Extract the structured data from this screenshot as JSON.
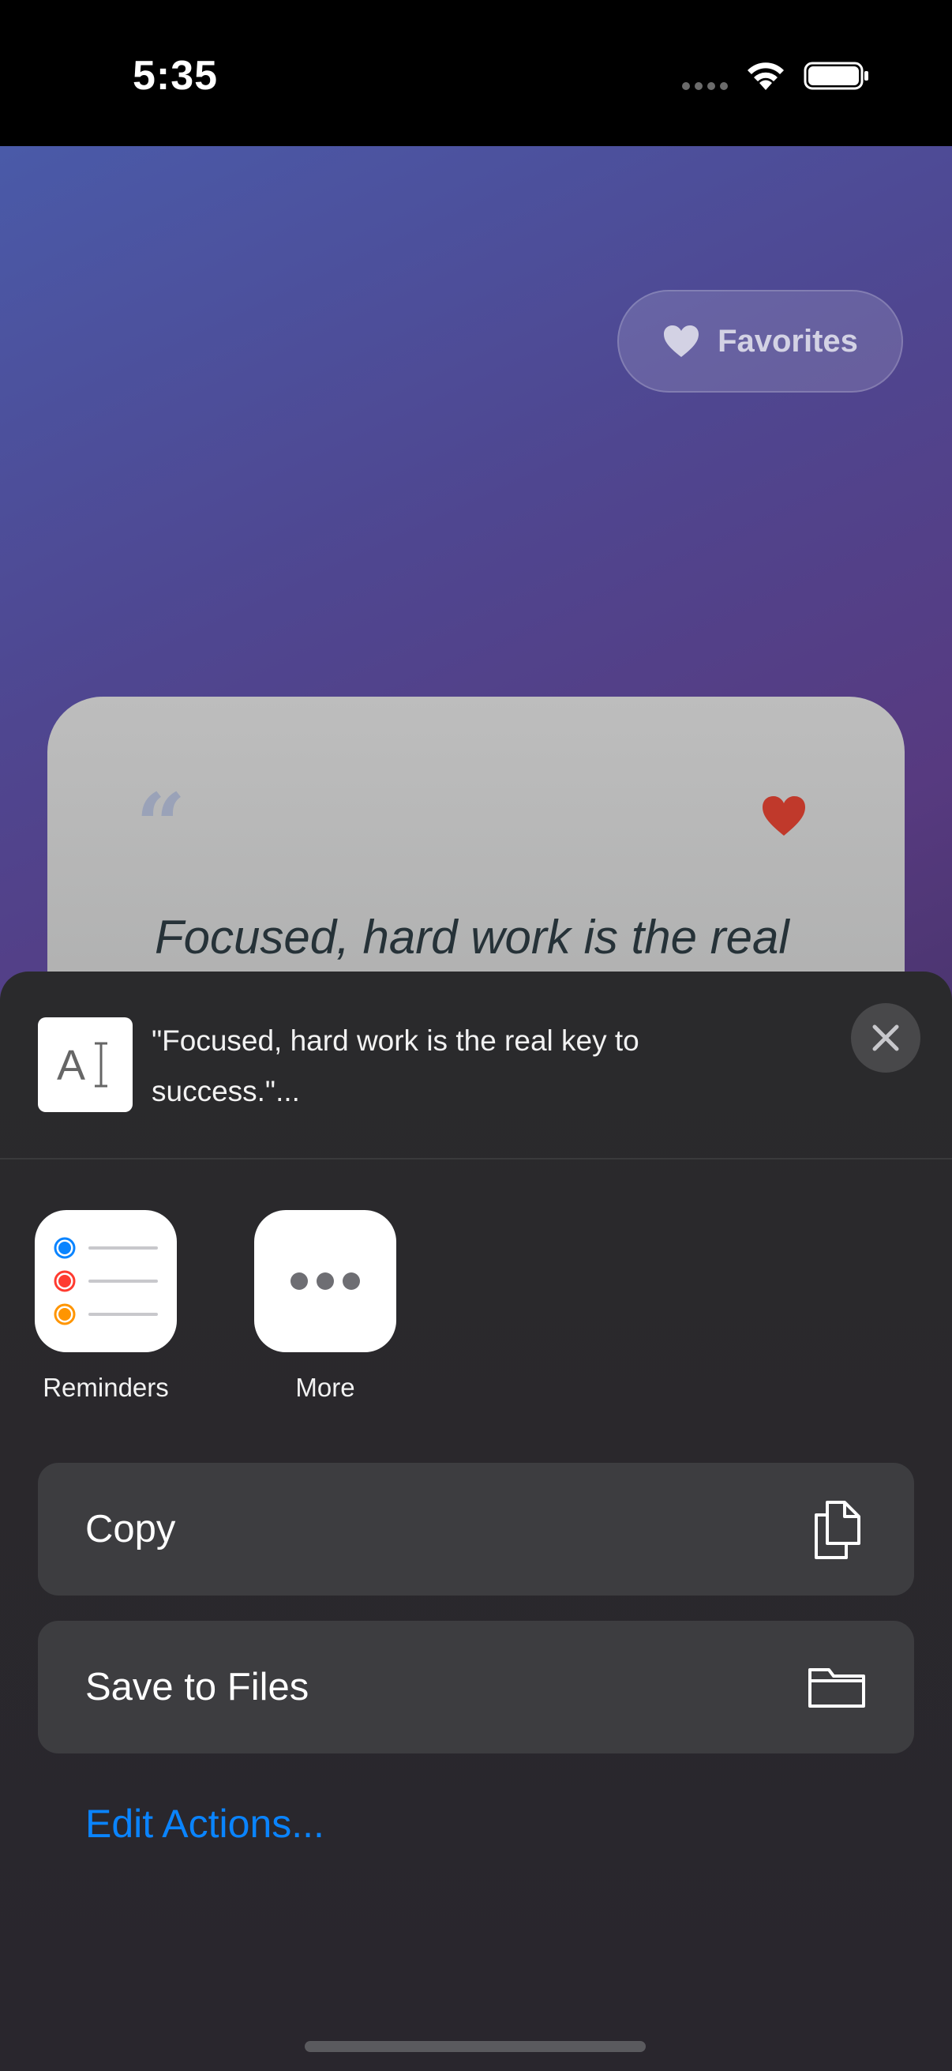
{
  "status_bar": {
    "time": "5:35"
  },
  "app": {
    "favorites_label": "Favorites",
    "quote_mark": "“",
    "quote_preview": "Focused, hard work is the real",
    "heart_color": "#c0392b"
  },
  "share_sheet": {
    "preview_text": "\"Focused, hard work is the real key to success.\"...",
    "apps": [
      {
        "label": "Reminders",
        "icon": "reminders-icon"
      },
      {
        "label": "More",
        "icon": "more-icon"
      }
    ],
    "actions": [
      {
        "label": "Copy",
        "icon": "copy-icon"
      },
      {
        "label": "Save to Files",
        "icon": "folder-icon"
      }
    ],
    "edit_actions": "Edit Actions...",
    "link_color": "#0a84ff"
  }
}
